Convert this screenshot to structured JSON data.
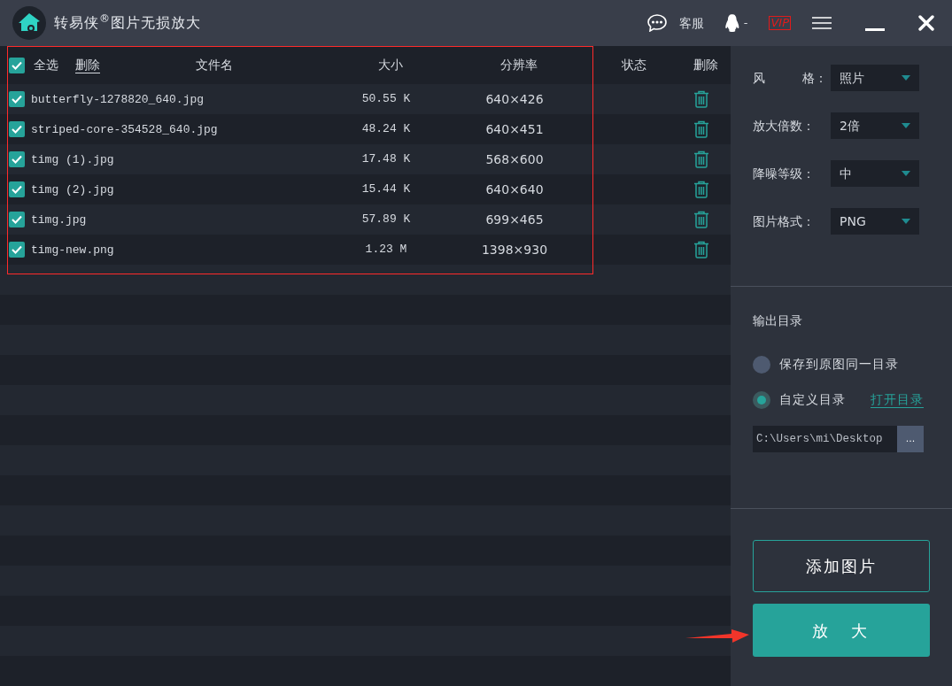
{
  "title_bar": {
    "title": "转易侠$^{®}$图片无损放大",
    "service_label": "客服",
    "account_label": "-",
    "vip_badge": "VIP"
  },
  "table": {
    "select_all": {
      "label": "全选",
      "checked": true
    },
    "delete_link": "删除",
    "columns": [
      "文件名",
      "大小",
      "分辨率",
      "状态",
      "删除"
    ],
    "rows": [
      {
        "name": "butterfly-1278820_640.jpg",
        "size": "50.55 K",
        "resolution": "640×426",
        "checked": true
      },
      {
        "name": "striped-core-354528_640.jpg",
        "size": "48.24 K",
        "resolution": "640×451",
        "checked": true
      },
      {
        "name": "timg (1).jpg",
        "size": "17.48 K",
        "resolution": "568×600",
        "checked": true
      },
      {
        "name": "timg (2).jpg",
        "size": "15.44 K",
        "resolution": "640×640",
        "checked": true
      },
      {
        "name": "timg.jpg",
        "size": "57.89 K",
        "resolution": "699×465",
        "checked": true
      },
      {
        "name": "timg-new.png",
        "size": "1.23 M",
        "resolution": "1398×930",
        "checked": true
      }
    ]
  },
  "settings": [
    {
      "label": "风　　　格：",
      "value": "照片"
    },
    {
      "label": "放大倍数：",
      "value": "2倍"
    },
    {
      "label": "降噪等级：",
      "value": "中"
    },
    {
      "label": "图片格式：",
      "value": "PNG"
    }
  ],
  "output": {
    "heading": "输出目录",
    "options": [
      {
        "label": "保存到原图同一目录",
        "selected": false
      },
      {
        "label": "自定义目录",
        "selected": true
      }
    ],
    "open_link": "打开目录",
    "path": "C:\\Users\\mi\\Desktop",
    "browse_button": "..."
  },
  "buttons": {
    "add": "添加图片",
    "enlarge": "放　大"
  },
  "annotation": {
    "frame": true,
    "arrow": true
  }
}
